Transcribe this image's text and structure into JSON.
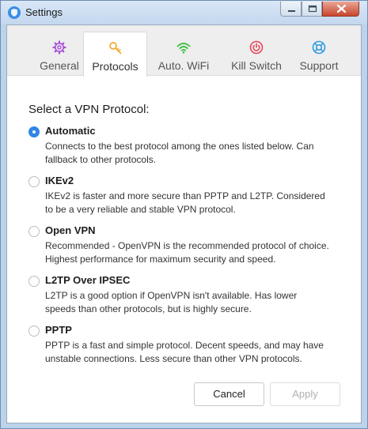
{
  "window": {
    "title": "Settings"
  },
  "tabs": [
    {
      "label": "General",
      "icon": "gear-icon",
      "color": "#a64fd6",
      "active": false
    },
    {
      "label": "Protocols",
      "icon": "key-icon",
      "color": "#f0a92a",
      "active": true
    },
    {
      "label": "Auto. WiFi",
      "icon": "wifi-icon",
      "color": "#3fbf45",
      "active": false
    },
    {
      "label": "Kill Switch",
      "icon": "power-icon",
      "color": "#e8455a",
      "active": false
    },
    {
      "label": "Support",
      "icon": "lifebuoy-icon",
      "color": "#2f9be0",
      "active": false
    }
  ],
  "protocols": {
    "heading": "Select a VPN Protocol:",
    "selected": "Automatic",
    "options": [
      {
        "title": "Automatic",
        "desc": "Connects to the best protocol among the ones listed below. Can fallback to other protocols."
      },
      {
        "title": "IKEv2",
        "desc": "IKEv2 is faster and more secure than PPTP and L2TP. Considered to be a very reliable and stable VPN protocol."
      },
      {
        "title": "Open VPN",
        "desc": "Recommended - OpenVPN is the recommended protocol of choice. Highest performance for maximum security and speed."
      },
      {
        "title": "L2TP Over IPSEC",
        "desc": "L2TP is a good option if OpenVPN isn't available. Has lower speeds than other protocols, but is highly secure."
      },
      {
        "title": "PPTP",
        "desc": "PPTP is a fast and simple protocol. Decent speeds, and may have unstable connections. Less secure than other VPN protocols."
      }
    ]
  },
  "buttons": {
    "cancel": "Cancel",
    "apply": "Apply",
    "apply_enabled": false
  },
  "colors": {
    "accent": "#2f86e3"
  }
}
